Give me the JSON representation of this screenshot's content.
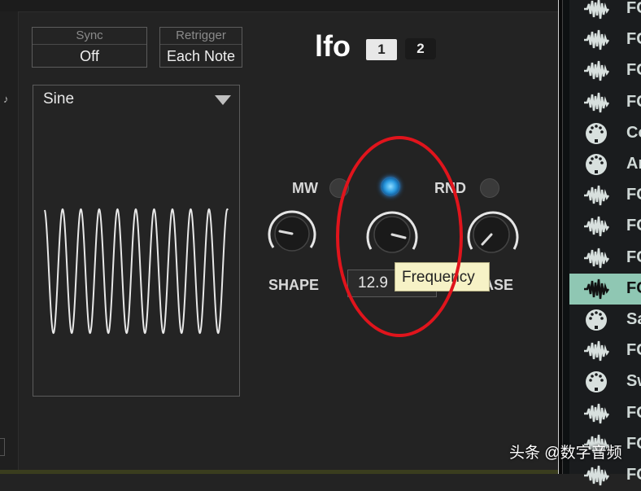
{
  "sync": {
    "label": "Sync",
    "value": "Off"
  },
  "retrigger": {
    "label": "Retrigger",
    "value": "Each Note"
  },
  "waveform": {
    "selected": "Sine",
    "cycles": 10
  },
  "lfo": {
    "title": "lfo",
    "tabs": [
      "1",
      "2"
    ],
    "active_tab": "1"
  },
  "mod": {
    "mw_label": "MW",
    "rnd_label": "RND",
    "mw_on": false,
    "freq_led_on": true,
    "rnd_on": false
  },
  "knobs": {
    "shape": {
      "label": "SHAPE"
    },
    "frequency": {
      "value": "12.9"
    },
    "phase": {
      "label": "ASE"
    }
  },
  "tooltip": {
    "text": "Frequency"
  },
  "left_glyph": "♪",
  "browser": {
    "items": [
      {
        "icon": "waveform-icon",
        "text": "FC"
      },
      {
        "icon": "waveform-icon",
        "text": "FC"
      },
      {
        "icon": "waveform-icon",
        "text": "FC"
      },
      {
        "icon": "waveform-icon",
        "text": "FC"
      },
      {
        "icon": "midi-icon",
        "text": "Co"
      },
      {
        "icon": "midi-icon",
        "text": "Ar"
      },
      {
        "icon": "waveform-icon",
        "text": "FC"
      },
      {
        "icon": "waveform-icon",
        "text": "FC"
      },
      {
        "icon": "waveform-icon",
        "text": "FC"
      },
      {
        "icon": "waveform-icon",
        "text": "FC",
        "selected": true
      },
      {
        "icon": "midi-icon",
        "text": "Sa"
      },
      {
        "icon": "waveform-icon",
        "text": "FC"
      },
      {
        "icon": "midi-icon",
        "text": "Sw"
      },
      {
        "icon": "waveform-icon",
        "text": "FC"
      },
      {
        "icon": "waveform-icon",
        "text": "FC"
      },
      {
        "icon": "waveform-icon",
        "text": "FC"
      }
    ]
  },
  "watermark": "头条 @数字音频",
  "colors": {
    "accent_led": "#2a9ae0",
    "highlight_row": "#8fc7b3",
    "annotation": "#e0141c",
    "tooltip_bg": "#f6f2c6"
  }
}
